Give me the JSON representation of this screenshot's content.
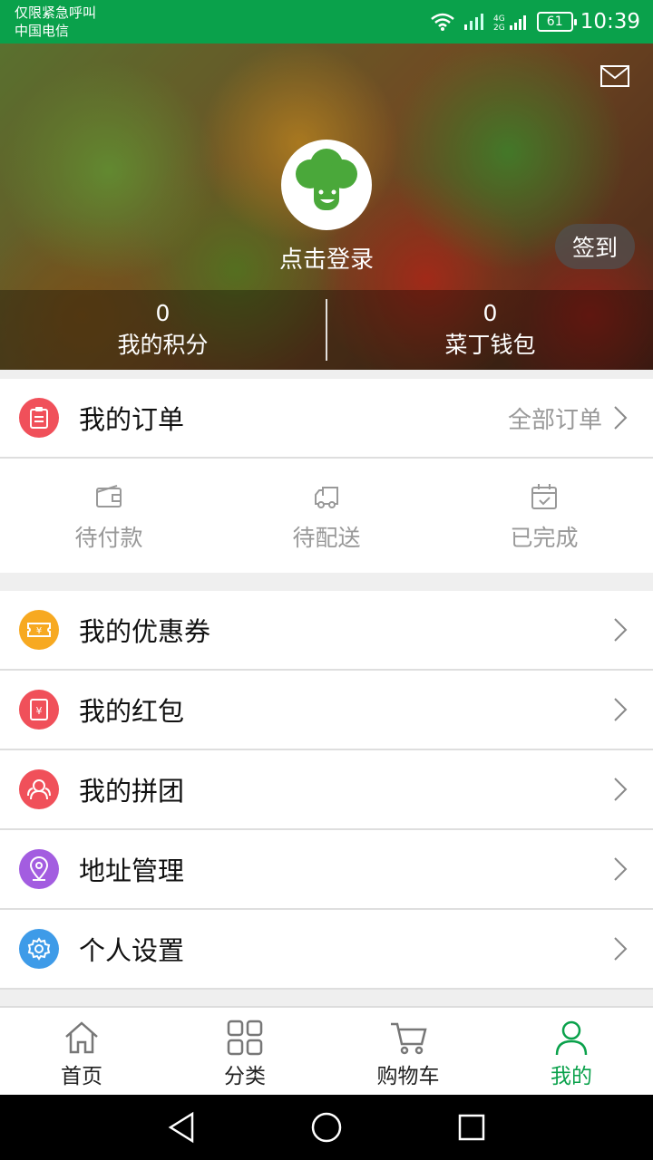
{
  "status_bar": {
    "line1": "仅限紧急呼叫",
    "line2": "中国电信",
    "battery": "61",
    "time": "10:39"
  },
  "header": {
    "login_text": "点击登录",
    "checkin_label": "签到",
    "stats": [
      {
        "value": "0",
        "label": "我的积分"
      },
      {
        "value": "0",
        "label": "菜丁钱包"
      }
    ]
  },
  "orders": {
    "title": "我的订单",
    "all_orders": "全部订单",
    "tabs": [
      {
        "label": "待付款",
        "icon": "wallet-icon"
      },
      {
        "label": "待配送",
        "icon": "truck-icon"
      },
      {
        "label": "已完成",
        "icon": "calendar-check-icon"
      }
    ]
  },
  "menu": [
    {
      "label": "我的优惠券",
      "icon": "coupon-icon",
      "color": "#f7a921"
    },
    {
      "label": "我的红包",
      "icon": "red-packet-icon",
      "color": "#f0505a"
    },
    {
      "label": "我的拼团",
      "icon": "group-icon",
      "color": "#f0505a"
    },
    {
      "label": "地址管理",
      "icon": "location-icon",
      "color": "#a35de0"
    },
    {
      "label": "个人设置",
      "icon": "settings-icon",
      "color": "#3e9be8"
    }
  ],
  "tab_bar": [
    {
      "label": "首页",
      "icon": "home-icon"
    },
    {
      "label": "分类",
      "icon": "category-icon"
    },
    {
      "label": "购物车",
      "icon": "cart-icon"
    },
    {
      "label": "我的",
      "icon": "user-icon",
      "active": true
    }
  ],
  "colors": {
    "brand_green": "#0aa14b",
    "order_icon": "#f0505a"
  }
}
